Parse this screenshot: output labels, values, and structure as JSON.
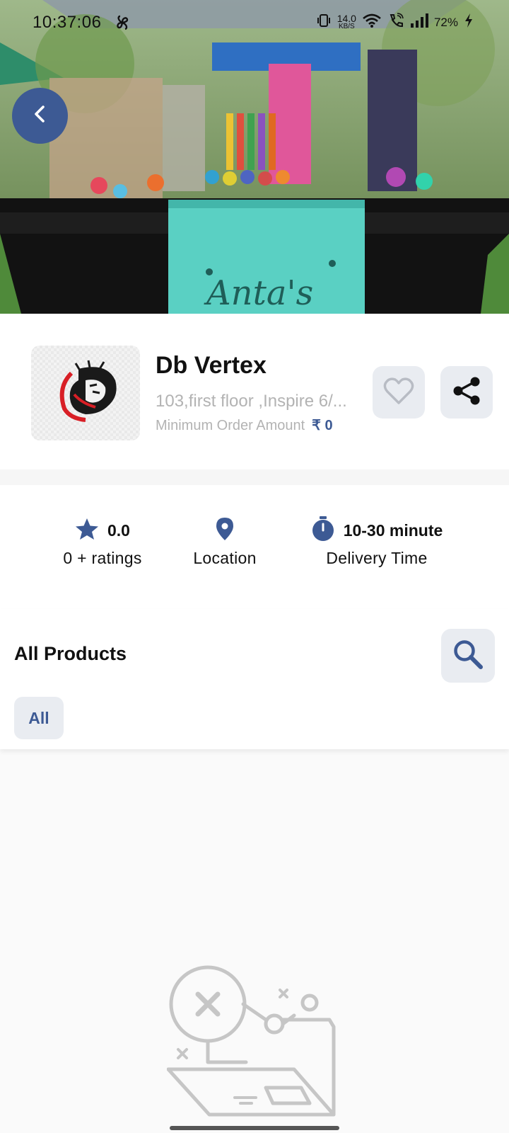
{
  "status_bar": {
    "time": "10:37:06",
    "net_speed_value": "14.0",
    "net_speed_unit": "KB/S",
    "battery": "72%"
  },
  "hero": {
    "banner_sign_text": "Anta's"
  },
  "store": {
    "name": "Db Vertex",
    "address": "103,first floor ,Inspire 6/...",
    "min_order_label": "Minimum Order Amount",
    "min_order_amount": "₹ 0"
  },
  "info": {
    "rating_value": "0.0",
    "rating_label": "0 + ratings",
    "location_label": "Location",
    "delivery_value": "10-30 minute",
    "delivery_label": "Delivery Time"
  },
  "products": {
    "title": "All Products",
    "categories": [
      {
        "label": "All",
        "selected": true
      }
    ]
  },
  "colors": {
    "accent": "#3d5a94",
    "button_bg": "#e9ecf1",
    "muted_text": "#b3b3b3"
  }
}
